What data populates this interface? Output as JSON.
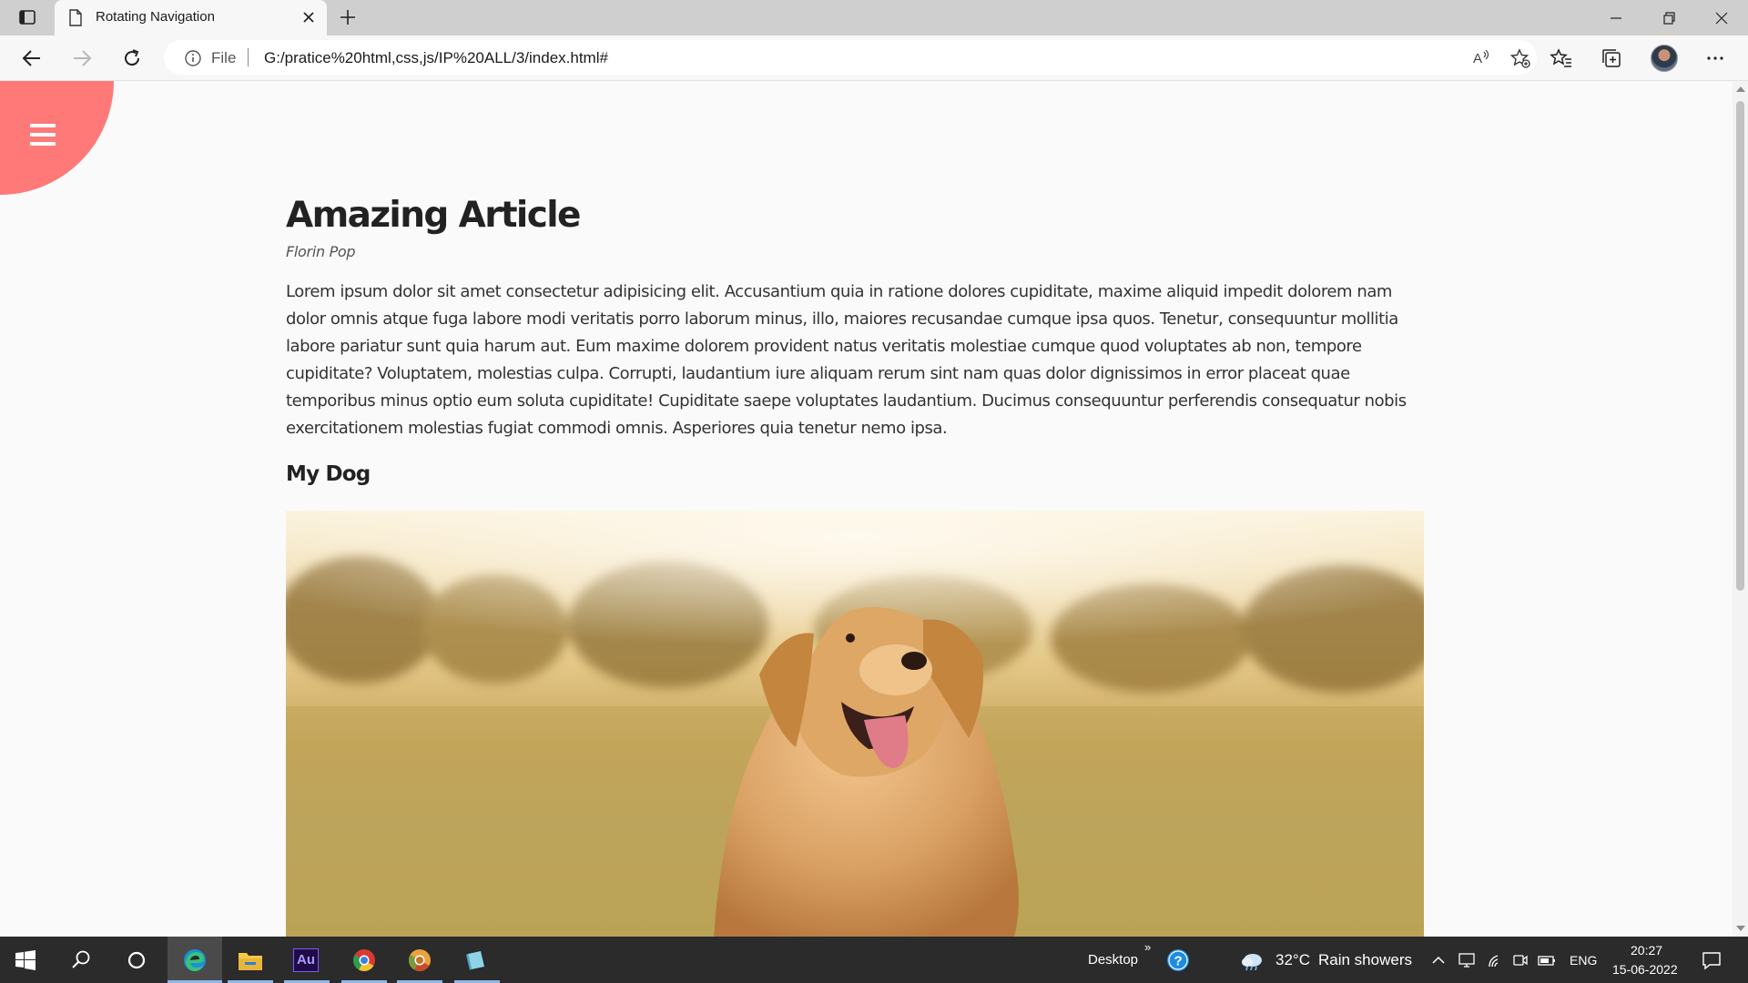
{
  "browser": {
    "tab_title": "Rotating Navigation",
    "address_scheme": "File",
    "address_url": "G:/pratice%20html,css,js/IP%20ALL/3/index.html#"
  },
  "article": {
    "title": "Amazing Article",
    "author": "Florin Pop",
    "body": "Lorem ipsum dolor sit amet consectetur adipisicing elit. Accusantium quia in ratione dolores cupiditate, maxime aliquid impedit dolorem nam dolor omnis atque fuga labore modi veritatis porro laborum minus, illo, maiores recusandae cumque ipsa quos. Tenetur, consequuntur mollitia labore pariatur sunt quia harum aut. Eum maxime dolorem provident natus veritatis molestiae cumque quod voluptates ab non, tempore cupiditate? Voluptatem, molestias culpa. Corrupti, laudantium iure aliquam rerum sint nam quas dolor dignissimos in error placeat quae temporibus minus optio eum soluta cupiditate! Cupiditate saepe voluptates laudantium. Ducimus consequuntur perferendis consequatur nobis exercitationem molestias fugiat commodi omnis. Asperiores quia tenetur nemo ipsa.",
    "subheading": "My Dog"
  },
  "taskbar": {
    "desktop_label": "Desktop",
    "weather_temp": "32°C",
    "weather_desc": "Rain showers",
    "language": "ENG",
    "time": "20:27",
    "date": "15-06-2022"
  },
  "colors": {
    "menu_circle": "#ff7979",
    "page_bg": "#fafafa",
    "taskbar_bg": "#2b2b2b"
  },
  "icons": [
    "tab-actions-icon",
    "page-icon",
    "close-icon",
    "plus-icon",
    "minimize-icon",
    "restore-icon",
    "close-window-icon",
    "back-icon",
    "forward-icon",
    "refresh-icon",
    "info-icon",
    "read-aloud-icon",
    "add-favorite-icon",
    "favorites-icon",
    "collections-icon",
    "more-icon",
    "hamburger-icon",
    "windows-start-icon",
    "search-icon",
    "cortana-icon",
    "edge-icon",
    "file-explorer-icon",
    "audition-icon",
    "chrome-icon",
    "chrome-canary-icon",
    "notepad-icon",
    "help-icon",
    "weather-icon",
    "chevron-up-icon",
    "network-icon",
    "wifi-icon",
    "meet-now-icon",
    "battery-icon",
    "notification-icon"
  ]
}
